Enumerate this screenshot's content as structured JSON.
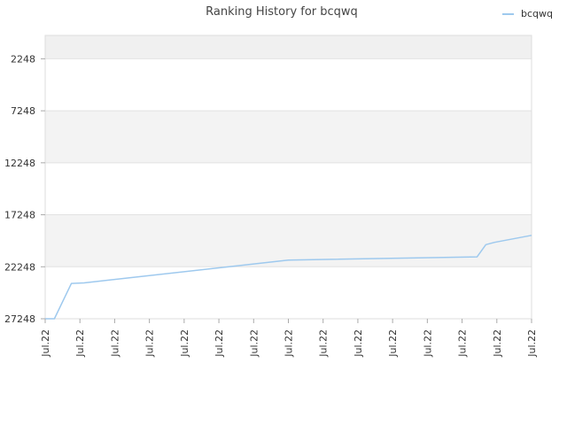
{
  "chart_data": {
    "type": "line",
    "title": "Ranking History for bcqwq",
    "xlabel": "",
    "ylabel": "",
    "y_inverted": true,
    "ylim": [
      27248,
      0
    ],
    "y_ticks": [
      2248,
      7248,
      12248,
      17248,
      22248,
      27248
    ],
    "y_tick_labels": [
      "2248",
      "7248",
      "12248",
      "17248",
      "22248",
      "27248"
    ],
    "x_tick_labels": [
      "Jul.22",
      "Jul.22",
      "Jul.22",
      "Jul.22",
      "Jul.22",
      "Jul.22",
      "Jul.22",
      "Jul.22",
      "Jul.22",
      "Jul.22",
      "Jul.22",
      "Jul.22",
      "Jul.22",
      "Jul.22",
      "Jul.22"
    ],
    "legend_position": "top-right",
    "grid": true,
    "series": [
      {
        "name": "bcqwq",
        "color": "#9ec9ee",
        "x": [
          0.0,
          0.019,
          0.054,
          0.08,
          0.5,
          0.888,
          0.906,
          0.924,
          1.0
        ],
        "values": [
          27248,
          27248,
          23848,
          23800,
          21600,
          21300,
          20120,
          19900,
          19230
        ]
      }
    ],
    "band_colors": [
      "#f0f0f0",
      "#ffffff",
      "#f3f3f3",
      "#ffffff",
      "#f3f3f3",
      "#ffffff"
    ]
  }
}
